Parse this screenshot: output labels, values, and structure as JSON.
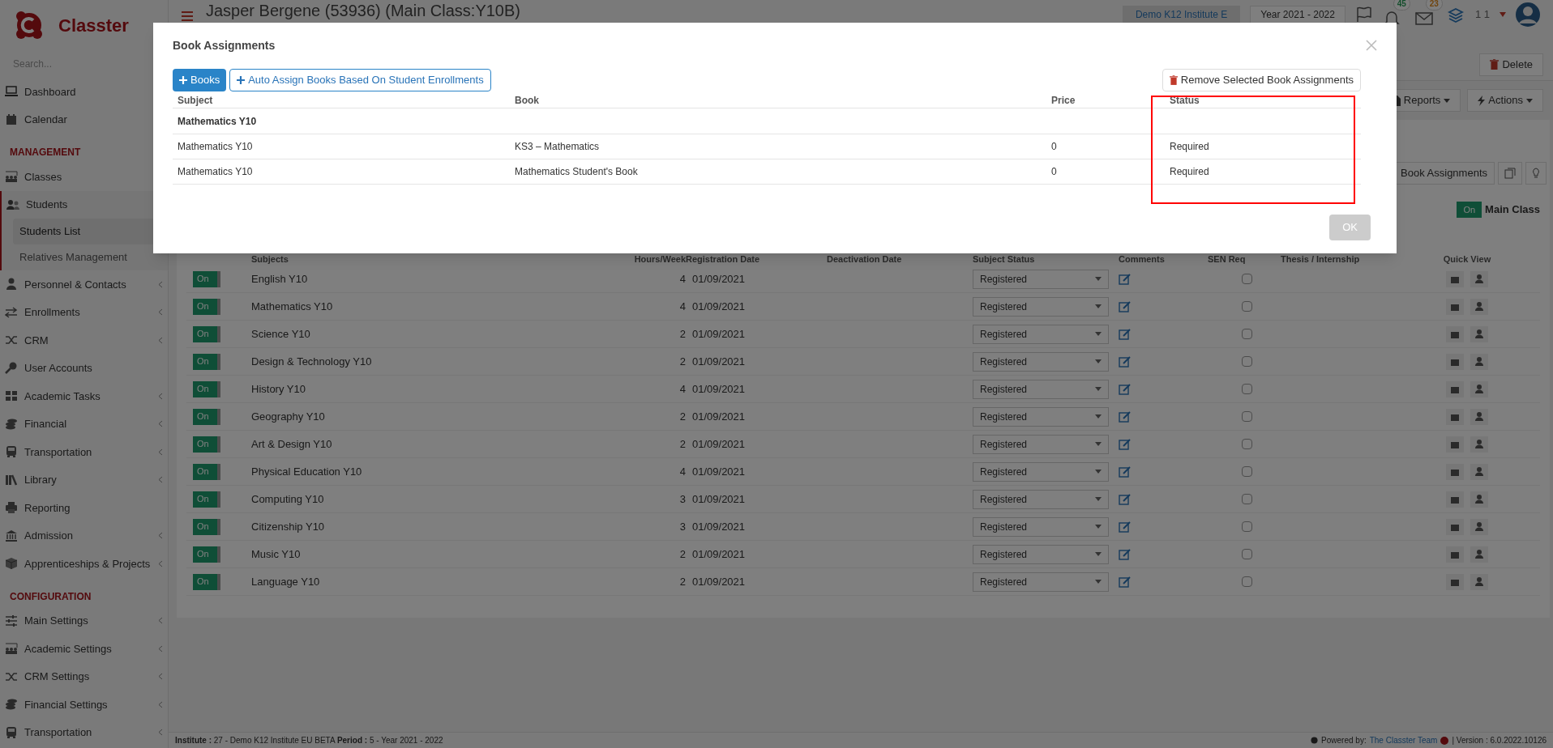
{
  "brand": {
    "name": "Classter"
  },
  "search": {
    "placeholder": "Search..."
  },
  "sidebar": {
    "items": [
      {
        "kind": "item",
        "label": "Dashboard",
        "expandable": false
      },
      {
        "kind": "item",
        "label": "Calendar",
        "expandable": false
      },
      {
        "kind": "section",
        "label": "MANAGEMENT"
      },
      {
        "kind": "item",
        "label": "Classes",
        "expandable": false
      },
      {
        "kind": "item",
        "label": "Students",
        "expandable": false,
        "expanded": true,
        "children": [
          {
            "label": "Students List",
            "selected": true
          },
          {
            "label": "Relatives Management",
            "selected": false
          }
        ]
      },
      {
        "kind": "item",
        "label": "Personnel & Contacts",
        "expandable": true
      },
      {
        "kind": "item",
        "label": "Enrollments",
        "expandable": true
      },
      {
        "kind": "item",
        "label": "CRM",
        "expandable": true
      },
      {
        "kind": "item",
        "label": "User Accounts",
        "expandable": false
      },
      {
        "kind": "item",
        "label": "Academic Tasks",
        "expandable": true
      },
      {
        "kind": "item",
        "label": "Financial",
        "expandable": true
      },
      {
        "kind": "item",
        "label": "Transportation",
        "expandable": true
      },
      {
        "kind": "item",
        "label": "Library",
        "expandable": true
      },
      {
        "kind": "item",
        "label": "Reporting",
        "expandable": false
      },
      {
        "kind": "item",
        "label": "Admission",
        "expandable": true
      },
      {
        "kind": "item",
        "label": "Apprenticeships & Projects",
        "expandable": true
      },
      {
        "kind": "section",
        "label": "CONFIGURATION"
      },
      {
        "kind": "item",
        "label": "Main Settings",
        "expandable": true
      },
      {
        "kind": "item",
        "label": "Academic Settings",
        "expandable": true
      },
      {
        "kind": "item",
        "label": "CRM Settings",
        "expandable": true
      },
      {
        "kind": "item",
        "label": "Financial Settings",
        "expandable": true
      },
      {
        "kind": "item",
        "label": "Transportation",
        "expandable": true
      }
    ]
  },
  "header": {
    "title": "Jasper Bergene (53936) (Main Class:Y10B)",
    "institute": "Demo K12 Institute E",
    "year": "Year 2021 - 2022",
    "notifications": "45",
    "messages": "23",
    "user": "1 1"
  },
  "toolbar": {
    "delete": "Delete",
    "reports": "Reports",
    "actions": "Actions",
    "book_assignments": "Book Assignments",
    "main_class": {
      "toggle": "On",
      "label": "Main Class",
      "on": true
    }
  },
  "subjects_table": {
    "columns": [
      "Subjects",
      "Hours/Week",
      "Registration Date",
      "Deactivation Date",
      "Subject Status",
      "Comments",
      "SEN Req",
      "Thesis / Internship",
      "Quick View"
    ],
    "rows": [
      {
        "on": true,
        "toggle": "On",
        "subject": "English Y10",
        "hours": "4",
        "date": "01/09/2021",
        "status": "Registered",
        "sen_req": false
      },
      {
        "on": true,
        "toggle": "On",
        "subject": "Mathematics Y10",
        "hours": "4",
        "date": "01/09/2021",
        "status": "Registered",
        "sen_req": false
      },
      {
        "on": true,
        "toggle": "On",
        "subject": "Science Y10",
        "hours": "2",
        "date": "01/09/2021",
        "status": "Registered",
        "sen_req": false
      },
      {
        "on": true,
        "toggle": "On",
        "subject": "Design & Technology Y10",
        "hours": "2",
        "date": "01/09/2021",
        "status": "Registered",
        "sen_req": false
      },
      {
        "on": true,
        "toggle": "On",
        "subject": "History Y10",
        "hours": "4",
        "date": "01/09/2021",
        "status": "Registered",
        "sen_req": false
      },
      {
        "on": true,
        "toggle": "On",
        "subject": "Geography Y10",
        "hours": "2",
        "date": "01/09/2021",
        "status": "Registered",
        "sen_req": false
      },
      {
        "on": true,
        "toggle": "On",
        "subject": "Art & Design Y10",
        "hours": "2",
        "date": "01/09/2021",
        "status": "Registered",
        "sen_req": false
      },
      {
        "on": true,
        "toggle": "On",
        "subject": "Physical Education Y10",
        "hours": "4",
        "date": "01/09/2021",
        "status": "Registered",
        "sen_req": false
      },
      {
        "on": true,
        "toggle": "On",
        "subject": "Computing Y10",
        "hours": "3",
        "date": "01/09/2021",
        "status": "Registered",
        "sen_req": false
      },
      {
        "on": true,
        "toggle": "On",
        "subject": "Citizenship Y10",
        "hours": "3",
        "date": "01/09/2021",
        "status": "Registered",
        "sen_req": false
      },
      {
        "on": true,
        "toggle": "On",
        "subject": "Music Y10",
        "hours": "2",
        "date": "01/09/2021",
        "status": "Registered",
        "sen_req": false
      },
      {
        "on": true,
        "toggle": "On",
        "subject": "Language Y10",
        "hours": "2",
        "date": "01/09/2021",
        "status": "Registered",
        "sen_req": false
      }
    ]
  },
  "status_bar": {
    "left": "**Institute :** 27 - Demo K12 Institute EU BETA **Period :** 5 - Year 2021 - 2022",
    "powered_by": "Powered by:",
    "team": "The Classter Team",
    "version": "| Version : 6.0.2022.10126"
  },
  "modal": {
    "title": "Book Assignments",
    "add_books": "Books",
    "auto_assign": "Auto Assign Books Based On Student Enrollments",
    "remove": "Remove Selected Book Assignments",
    "columns": [
      "Subject",
      "Book",
      "Price",
      "Status"
    ],
    "group": "Mathematics Y10",
    "rows": [
      {
        "subject": "Mathematics Y10",
        "book": "KS3 – Mathematics",
        "price": "0",
        "status": "Required"
      },
      {
        "subject": "Mathematics Y10",
        "book": "Mathematics Student's Book",
        "price": "0",
        "status": "Required"
      }
    ],
    "ok": "OK"
  }
}
